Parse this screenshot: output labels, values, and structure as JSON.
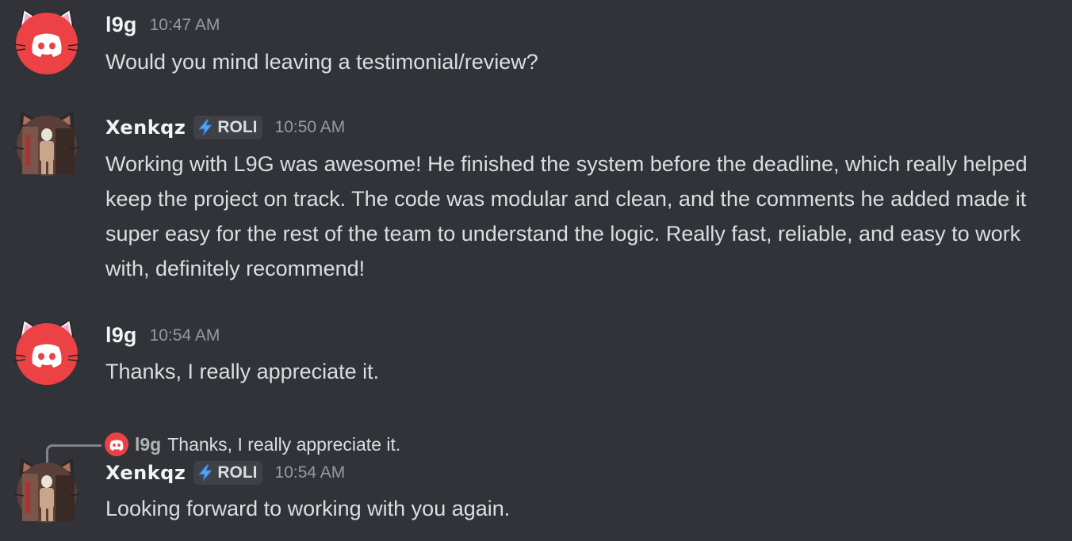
{
  "messages": [
    {
      "author": "l9g",
      "time": "10:47 AM",
      "text": "Would you mind leaving a testimonial/review?"
    },
    {
      "author": "Xenkqz",
      "tag": "ROLI",
      "tag_icon": "lightning-icon",
      "time": "10:50 AM",
      "text": "Working with L9G was awesome! He finished the system before the deadline, which really helped keep the project on track. The code was modular and clean, and the comments he added made it super easy for the rest of the team to understand the logic. Really fast, reliable, and easy to work with, definitely recommend!"
    },
    {
      "author": "l9g",
      "time": "10:54 AM",
      "text": "Thanks, I really appreciate it."
    },
    {
      "author": "Xenkqz",
      "tag": "ROLI",
      "tag_icon": "lightning-icon",
      "time": "10:54 AM",
      "text": "Looking forward to working with you again.",
      "reply": {
        "author": "l9g",
        "text": "Thanks, I really appreciate it."
      }
    }
  ],
  "colors": {
    "background": "#313338",
    "discord_red": "#ed4245",
    "text": "#dbdee1",
    "timestamp": "#949ba4",
    "tag_bg": "#3f4147",
    "lightning": "#5aa2f0"
  }
}
